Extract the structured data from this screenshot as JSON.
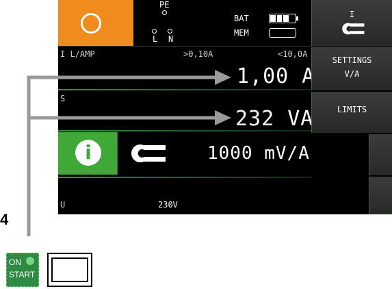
{
  "status": {
    "pe_label": "PE",
    "l_label": "L",
    "n_label": "N",
    "bat_label": "BAT",
    "mem_label": "MEM",
    "battery_level": 0.75
  },
  "row1": {
    "label": "I L/AMP",
    "range_low": ">0,10A",
    "range_high": "<10,0A",
    "value": "1,00 A"
  },
  "row2": {
    "label": "S",
    "value": "232 VA"
  },
  "info": {
    "icon": "info-icon",
    "clamp_icon": "clamp-icon",
    "ratio": "1000 mV/A"
  },
  "footer": {
    "label": "U",
    "voltage": "230V"
  },
  "softkeys": {
    "current_label": "I",
    "current_icon": "clamp-icon",
    "settings_label": "SETTINGS",
    "settings_sub": "V/A",
    "limits_label": "LIMITS"
  },
  "callout": {
    "number": "4"
  },
  "button": {
    "on_label": "ON",
    "start_label": "START"
  },
  "colors": {
    "accent_orange": "#f08c1e",
    "info_green": "#40a836",
    "divider_green": "#2c9a3e"
  }
}
